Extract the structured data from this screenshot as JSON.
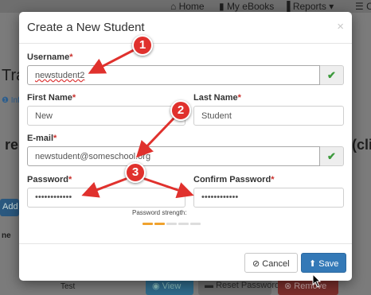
{
  "background": {
    "nav": {
      "home_label": "Home",
      "ebooks_label": "My eBooks",
      "reports_label": "Reports",
      "reports_caret": "▾",
      "truncated_label": "C"
    },
    "text_fragments": {
      "title_partial": "Tra",
      "info_partial": "Inf",
      "heading_partial": "re",
      "paren_partial": "(cli",
      "add_partial": "Add",
      "name_partial": "ne",
      "test_text": "Test"
    },
    "buttons": {
      "view": "View",
      "reset_password": "Reset Password",
      "remove": "Remove"
    }
  },
  "modal": {
    "title": "Create a New Student",
    "close": "×",
    "username": {
      "label": "Username",
      "required": "*",
      "value": "newstudent2"
    },
    "first_name": {
      "label": "First Name",
      "required": "*",
      "value": "New"
    },
    "last_name": {
      "label": "Last Name",
      "required": "*",
      "value": "Student"
    },
    "email": {
      "label": "E-mail",
      "required": "*",
      "value": "newstudent@someschool.org"
    },
    "password": {
      "label": "Password",
      "required": "*",
      "value": "••••••••••••"
    },
    "confirm_password": {
      "label": "Confirm Password",
      "required": "*",
      "value": "••••••••••••"
    },
    "password_strength": {
      "label": "Password strength:",
      "level": 2,
      "segments": 5
    },
    "cancel_label": "Cancel",
    "save_label": "Save"
  },
  "annotations": {
    "callout_1": "1",
    "callout_2": "2",
    "callout_3": "3"
  },
  "colors": {
    "accent": "#3479b7",
    "valid": "#3c9a3c",
    "required": "#c9302c",
    "callout": "#e0312d",
    "strength_on": "#f0a22e",
    "strength_off": "#dddddd"
  }
}
